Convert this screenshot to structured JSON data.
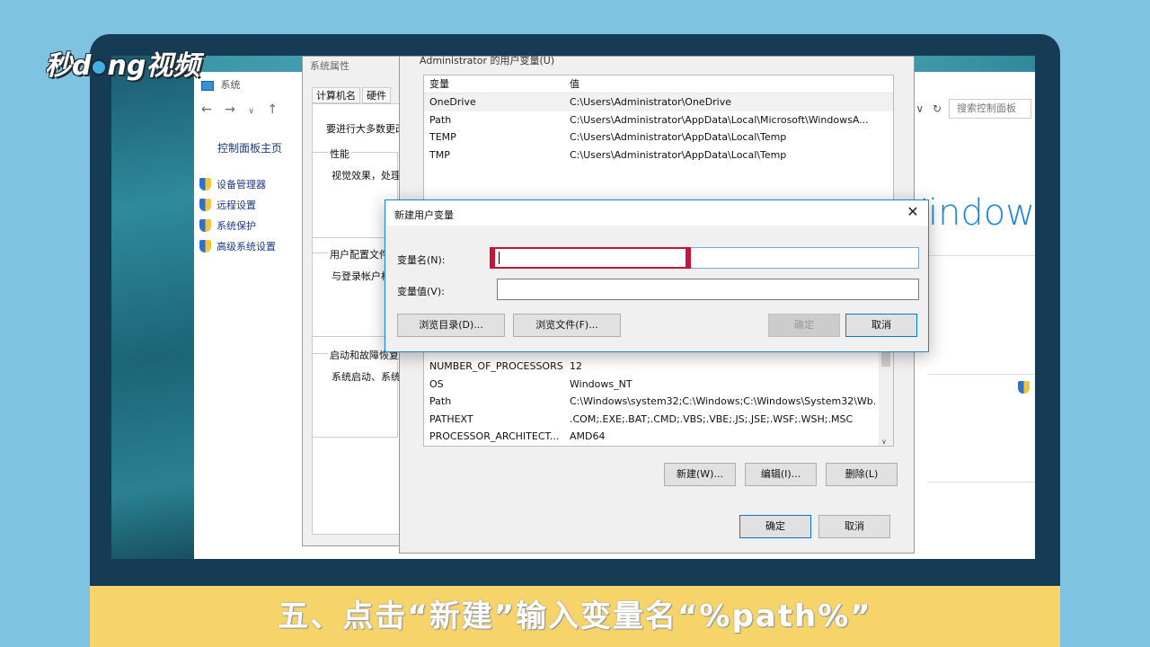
{
  "branding": {
    "logo_text_left": "秒d",
    "logo_text_right": "ng视频"
  },
  "caption": "五、点击“新建”输入变量名“%path%”",
  "system_window": {
    "title": "系统",
    "home_link": "控制面板主页",
    "tasks": [
      "设备管理器",
      "远程设置",
      "系统保护",
      "高级系统设置"
    ],
    "search_placeholder": "搜索控制面板",
    "windows_text": "Window"
  },
  "system_properties": {
    "title": "系统属性",
    "tabs": [
      "计算机名",
      "硬件"
    ],
    "intro_text": "要进行大多数更改",
    "groups": [
      {
        "label": "性能",
        "text": "视觉效果，处理"
      },
      {
        "label": "用户配置文件",
        "text": "与登录帐户相"
      },
      {
        "label": "启动和故障恢复",
        "text": "系统启动、系统"
      }
    ]
  },
  "env_vars": {
    "user_section_label": "Administrator 的用户变量(U)",
    "columns": {
      "name": "变量",
      "value": "值"
    },
    "user_vars": [
      {
        "name": "OneDrive",
        "value": "C:\\Users\\Administrator\\OneDrive"
      },
      {
        "name": "Path",
        "value": "C:\\Users\\Administrator\\AppData\\Local\\Microsoft\\WindowsA..."
      },
      {
        "name": "TEMP",
        "value": "C:\\Users\\Administrator\\AppData\\Local\\Temp"
      },
      {
        "name": "TMP",
        "value": "C:\\Users\\Administrator\\AppData\\Local\\Temp"
      }
    ],
    "system_vars": [
      {
        "name": "NUMBER_OF_PROCESSORS",
        "value": "12"
      },
      {
        "name": "OS",
        "value": "Windows_NT"
      },
      {
        "name": "Path",
        "value": "C:\\Windows\\system32;C:\\Windows;C:\\Windows\\System32\\Wb..."
      },
      {
        "name": "PATHEXT",
        "value": ".COM;.EXE;.BAT;.CMD;.VBS;.VBE;.JS;.JSE;.WSF;.WSH;.MSC"
      },
      {
        "name": "PROCESSOR_ARCHITECT...",
        "value": "AMD64"
      }
    ],
    "buttons": {
      "new": "新建(W)...",
      "edit": "编辑(I)...",
      "delete": "删除(L)"
    },
    "footer": {
      "ok": "确定",
      "cancel": "取消"
    }
  },
  "new_var_dialog": {
    "title": "新建用户变量",
    "name_label": "变量名(N):",
    "name_value": "",
    "value_label": "变量值(V):",
    "value_value": "",
    "browse_dir": "浏览目录(D)...",
    "browse_file": "浏览文件(F)...",
    "ok": "确定",
    "cancel": "取消",
    "close_glyph": "✕"
  }
}
